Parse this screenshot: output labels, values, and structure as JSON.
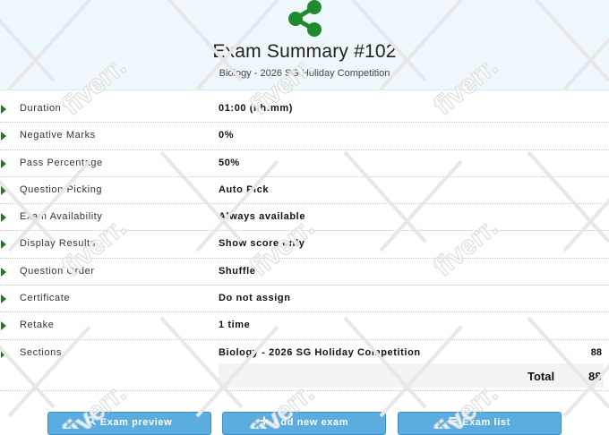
{
  "header": {
    "title": "Exam Summary #102",
    "subtitle": "Biology - 2026 SG Holiday Competition",
    "icon": "share-icon"
  },
  "rows": [
    {
      "label": "Duration",
      "value": "01:00 (hh:mm)"
    },
    {
      "label": "Negative Marks",
      "value": "0%"
    },
    {
      "label": "Pass Percentage",
      "value": "50%"
    },
    {
      "label": "Question Picking",
      "value": "Auto Pick"
    },
    {
      "label": "Exam Availability",
      "value": "Always available"
    },
    {
      "label": "Display Results",
      "value": "Show score only"
    },
    {
      "label": "Question Order",
      "value": "Shuffle"
    },
    {
      "label": "Certificate",
      "value": "Do not assign"
    },
    {
      "label": "Retake",
      "value": "1 time"
    }
  ],
  "sections": {
    "label": "Sections",
    "items": [
      {
        "name": "Biology - 2026 SG Holiday Competition",
        "count": "88"
      }
    ],
    "total_label": "Total",
    "total_value": "88"
  },
  "buttons": {
    "preview": {
      "icon": "search-icon",
      "label": "Exam preview"
    },
    "add": {
      "icon": "plus-icon",
      "label": "Add new exam"
    },
    "list": {
      "icon": "list-icon",
      "label": "Exam list"
    }
  },
  "watermark": {
    "text": "fiverr."
  },
  "colors": {
    "header_bg": "#eef7fc",
    "icon_green": "#1f8a2e",
    "button_blue": "#5bade0",
    "arrow_green": "#1f7a1f"
  }
}
